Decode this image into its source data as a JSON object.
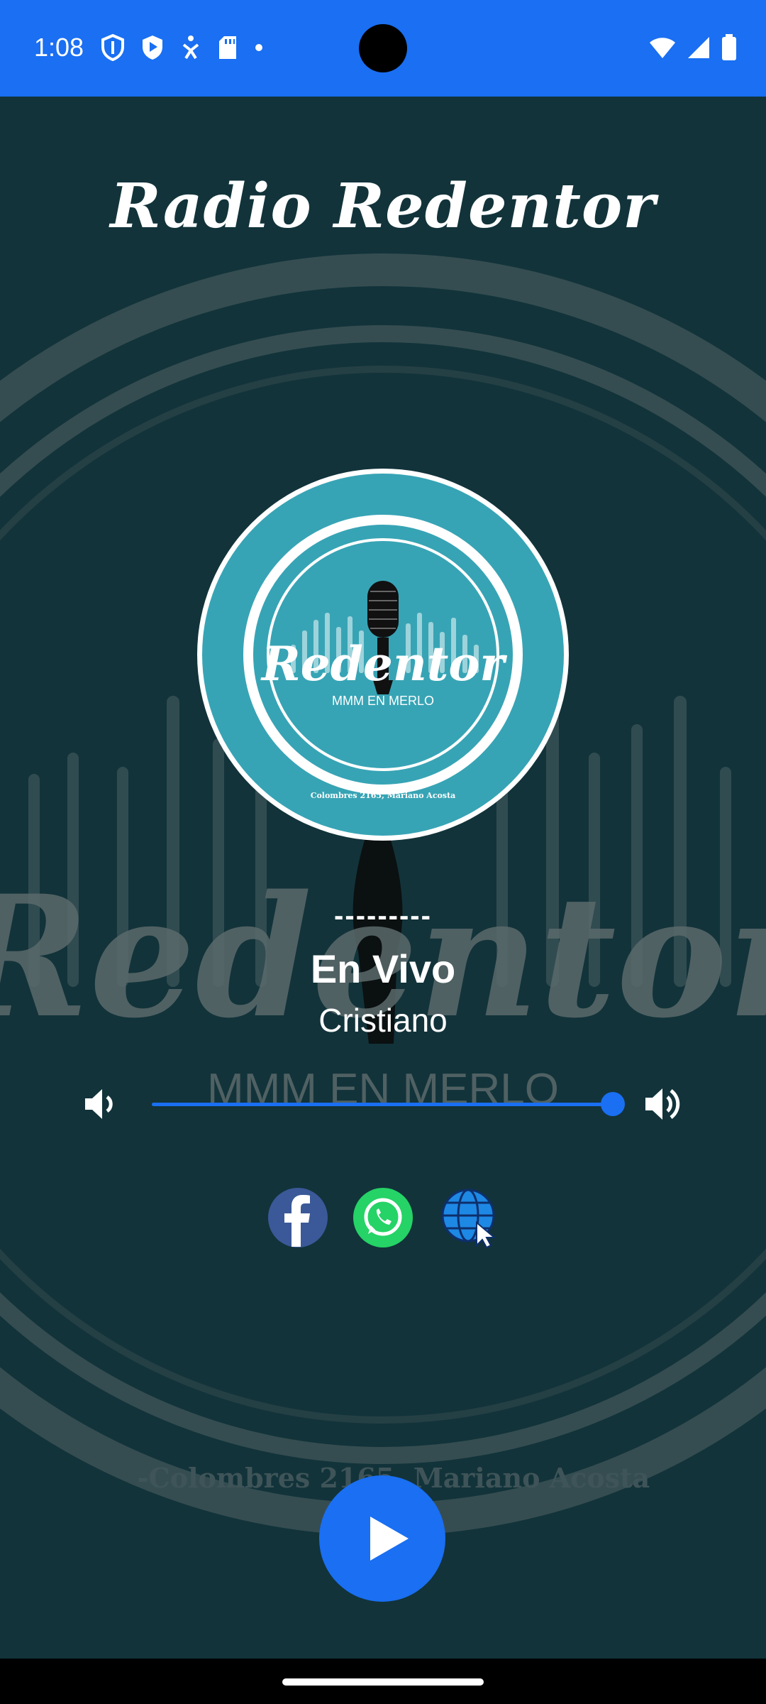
{
  "status_bar": {
    "time": "1:08",
    "left_icons": [
      "shield-icon",
      "play-protect-icon",
      "accessibility-icon",
      "sd-card-icon",
      "dot-icon"
    ],
    "right_icons": [
      "wifi-icon",
      "signal-icon",
      "battery-icon"
    ],
    "color": "#1a6ff2"
  },
  "app": {
    "title": "Radio Redentor",
    "accent_color": "#1a6ff2",
    "background_color": "#12333a"
  },
  "logo": {
    "wordmark": "Redentor",
    "tagline": "MMM EN MERLO",
    "address": "Colombres 2165, Mariano Acosta"
  },
  "background_watermark": {
    "wordmark": "Redentor",
    "tagline": "MMM EN MERLO",
    "address": "-Colombres 2165, Mariano Acosta"
  },
  "now_playing": {
    "separator": "---------",
    "title": "En Vivo",
    "subtitle": "Cristiano"
  },
  "volume": {
    "level_percent": 100,
    "down_icon": "volume-down-icon",
    "up_icon": "volume-up-icon"
  },
  "social": {
    "items": [
      {
        "icon": "facebook-icon",
        "color": "#3b5998"
      },
      {
        "icon": "whatsapp-icon",
        "color": "#25d366"
      },
      {
        "icon": "website-globe-icon",
        "color": "#1e88e5"
      }
    ]
  },
  "player": {
    "action_icon": "play-icon"
  }
}
